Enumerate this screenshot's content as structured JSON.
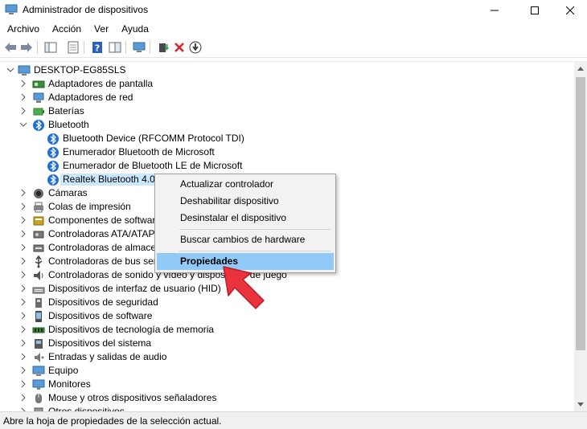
{
  "window": {
    "title": "Administrador de dispositivos"
  },
  "menu": [
    "Archivo",
    "Acción",
    "Ver",
    "Ayuda"
  ],
  "tree": {
    "root": "DESKTOP-EG85SLS",
    "items": [
      {
        "label": "Adaptadores de pantalla",
        "icon": "display-adapter-icon"
      },
      {
        "label": "Adaptadores de red",
        "icon": "network-adapter-icon"
      },
      {
        "label": "Baterías",
        "icon": "battery-icon"
      },
      {
        "label": "Bluetooth",
        "icon": "bluetooth-icon"
      },
      {
        "label": "Bluetooth Device (RFCOMM Protocol TDI)",
        "icon": "bluetooth-icon"
      },
      {
        "label": "Enumerador Bluetooth de Microsoft",
        "icon": "bluetooth-icon"
      },
      {
        "label": "Enumerador de Bluetooth LE de Microsoft",
        "icon": "bluetooth-icon"
      },
      {
        "label": "Realtek Bluetooth 4.0 Ad",
        "icon": "bluetooth-icon"
      },
      {
        "label": "Cámaras",
        "icon": "camera-icon"
      },
      {
        "label": "Colas de impresión",
        "icon": "printer-icon"
      },
      {
        "label": "Componentes de software",
        "icon": "software-component-icon"
      },
      {
        "label": "Controladoras ATA/ATAPI I",
        "icon": "ata-controller-icon"
      },
      {
        "label": "Controladoras de almacen",
        "icon": "storage-controller-icon"
      },
      {
        "label": "Controladoras de bus serie",
        "icon": "usb-icon"
      },
      {
        "label": "Controladoras de sonido y vídeo y dispositivos de juego",
        "icon": "sound-icon"
      },
      {
        "label": "Dispositivos de interfaz de usuario (HID)",
        "icon": "hid-icon"
      },
      {
        "label": "Dispositivos de seguridad",
        "icon": "security-device-icon"
      },
      {
        "label": "Dispositivos de software",
        "icon": "software-device-icon"
      },
      {
        "label": "Dispositivos de tecnología de memoria",
        "icon": "memory-icon"
      },
      {
        "label": "Dispositivos del sistema",
        "icon": "system-device-icon"
      },
      {
        "label": "Entradas y salidas de audio",
        "icon": "audio-io-icon"
      },
      {
        "label": "Equipo",
        "icon": "computer-icon"
      },
      {
        "label": "Monitores",
        "icon": "monitor-icon"
      },
      {
        "label": "Mouse y otros dispositivos señaladores",
        "icon": "mouse-icon"
      },
      {
        "label": "Otros dispositivos",
        "icon": "other-device-icon"
      }
    ]
  },
  "context_menu": {
    "items": [
      "Actualizar controlador",
      "Deshabilitar dispositivo",
      "Desinstalar el dispositivo",
      "Buscar cambios de hardware",
      "Propiedades"
    ]
  },
  "status": {
    "text": "Abre la hoja de propiedades de la selección actual."
  },
  "colors": {
    "selection": "#cce8ff",
    "menu_highlight": "#91c9f7",
    "bluetooth": "#1e6fd9",
    "arrow": "#e8323c"
  }
}
